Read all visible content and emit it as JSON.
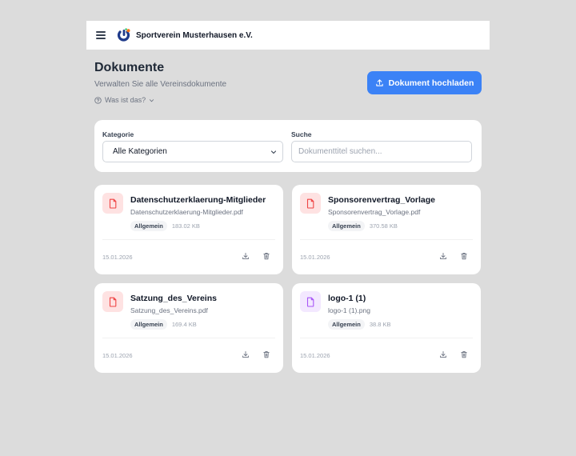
{
  "app": {
    "brand": "Sportverein Musterhausen e.V."
  },
  "page": {
    "title": "Dokumente",
    "subtitle": "Verwalten Sie alle Vereinsdokumente",
    "help_link": "Was ist das?",
    "upload_button": "Dokument hochladen"
  },
  "filters": {
    "category_label": "Kategorie",
    "category_value": "Alle Kategorien",
    "search_label": "Suche",
    "search_placeholder": "Dokumenttitel suchen..."
  },
  "documents": [
    {
      "title": "Datenschutzerklaerung-Mitglieder",
      "filename": "Datenschutzerklaerung-Mitglieder.pdf",
      "category": "Allgemein",
      "size": "183.02 KB",
      "date": "15.01.2026",
      "type": "pdf"
    },
    {
      "title": "Sponsorenvertrag_Vorlage",
      "filename": "Sponsorenvertrag_Vorlage.pdf",
      "category": "Allgemein",
      "size": "370.58 KB",
      "date": "15.01.2026",
      "type": "pdf"
    },
    {
      "title": "Satzung_des_Vereins",
      "filename": "Satzung_des_Vereins.pdf",
      "category": "Allgemein",
      "size": "169.4 KB",
      "date": "15.01.2026",
      "type": "pdf"
    },
    {
      "title": "logo-1 (1)",
      "filename": "logo-1 (1).png",
      "category": "Allgemein",
      "size": "38.8 KB",
      "date": "15.01.2026",
      "type": "image"
    }
  ],
  "colors": {
    "accent": "#3b82f6",
    "pdf_icon_bg": "#fee2e2",
    "pdf_icon": "#ef4444",
    "image_icon_bg": "#f3e8ff",
    "image_icon": "#a855f7"
  }
}
